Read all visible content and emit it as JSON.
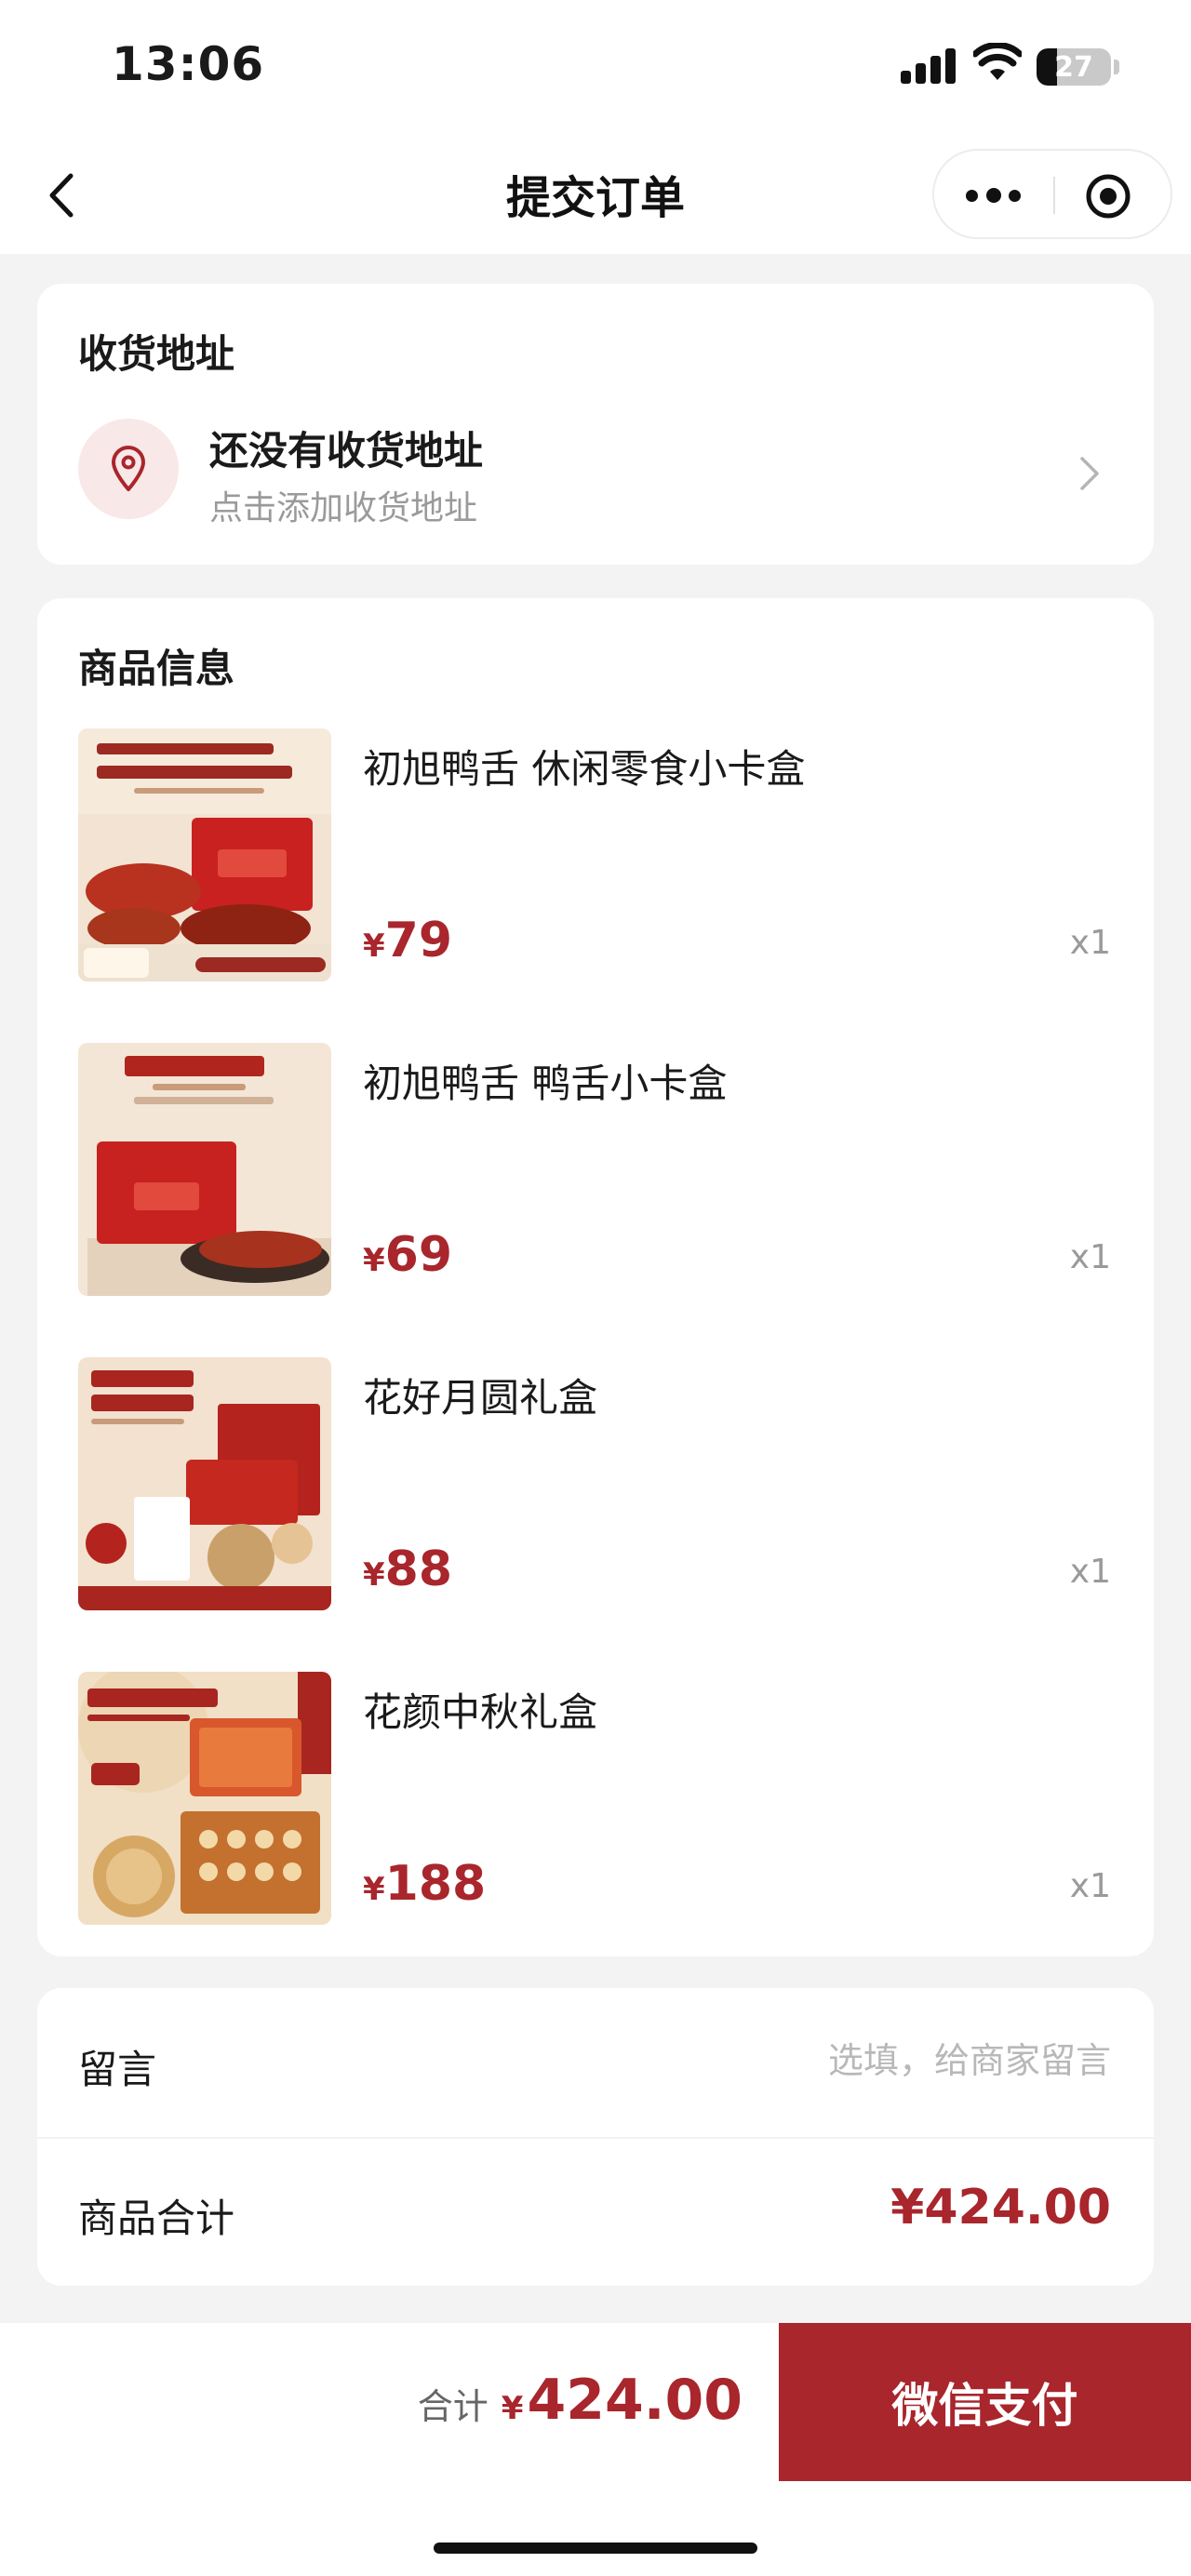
{
  "status_bar": {
    "time": "13:06",
    "battery": "27",
    "battery_level": 0.27
  },
  "nav": {
    "title": "提交订单"
  },
  "address": {
    "section_title": "收货地址",
    "empty_title": "还没有收货地址",
    "empty_hint": "点击添加收货地址"
  },
  "goods": {
    "section_title": "商品信息",
    "items": [
      {
        "name": "初旭鸭舌 休闲零食小卡盒",
        "currency": "¥",
        "price": "79",
        "qty": "x1"
      },
      {
        "name": "初旭鸭舌 鸭舌小卡盒",
        "currency": "¥",
        "price": "69",
        "qty": "x1"
      },
      {
        "name": "花好月圆礼盒",
        "currency": "¥",
        "price": "88",
        "qty": "x1"
      },
      {
        "name": "花颜中秋礼盒",
        "currency": "¥",
        "price": "188",
        "qty": "x1"
      }
    ]
  },
  "message": {
    "label": "留言",
    "placeholder": "选填，给商家留言",
    "value": ""
  },
  "subtotal": {
    "label": "商品合计",
    "value": "¥424.00"
  },
  "footer": {
    "total_label": "合计",
    "currency": "¥",
    "total": "424.00",
    "pay_label": "微信支付"
  },
  "theme": {
    "accent": "#a8262c",
    "pin_bg": "#f9e8e8",
    "page_bg": "#f3f3f3"
  }
}
